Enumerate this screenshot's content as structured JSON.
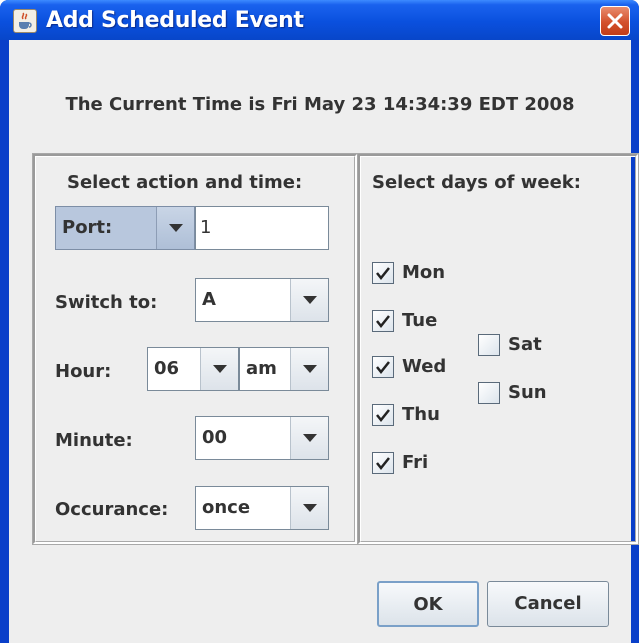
{
  "window": {
    "title": "Add Scheduled Event",
    "icon": "java-cup-icon",
    "close_icon": "close-icon"
  },
  "current_time": "The Current Time is Fri May 23 14:34:39 EDT 2008",
  "left_panel": {
    "title": "Select action and time:",
    "port": {
      "selected": "Port:",
      "value": "1"
    },
    "switch_to": {
      "label": "Switch to:",
      "value": "A"
    },
    "hour": {
      "label": "Hour:",
      "value": "06",
      "ampm": "am"
    },
    "minute": {
      "label": "Minute:",
      "value": "00"
    },
    "occurance": {
      "label": "Occurance:",
      "value": "once"
    }
  },
  "right_panel": {
    "title": "Select days of week:",
    "days": [
      {
        "label": "Mon",
        "checked": true
      },
      {
        "label": "Tue",
        "checked": true
      },
      {
        "label": "Wed",
        "checked": true
      },
      {
        "label": "Thu",
        "checked": true
      },
      {
        "label": "Fri",
        "checked": true
      },
      {
        "label": "Sat",
        "checked": false
      },
      {
        "label": "Sun",
        "checked": false
      }
    ]
  },
  "buttons": {
    "ok": "OK",
    "cancel": "Cancel"
  },
  "colors": {
    "titlebar": "#0a50de",
    "client_background": "#eeeeee",
    "close_button": "#d3512c"
  }
}
